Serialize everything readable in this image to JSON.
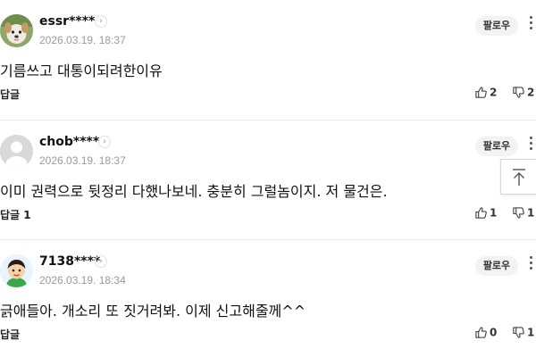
{
  "comments": [
    {
      "user": "essr****",
      "date": "2026.03.19. 18:37",
      "follow_label": "팔로우",
      "text": "기름쓰고 대통이되려한이유",
      "reply_label": "답글",
      "likes": "2",
      "dislikes": "2",
      "avatar": "dog-photo"
    },
    {
      "user": "chob****",
      "date": "2026.03.19. 18:37",
      "follow_label": "팔로우",
      "text": "이미 권력으로 뒷정리 다했나보네. 충분히 그럴놈이지. 저 물건은.",
      "reply_label": "답글 1",
      "likes": "1",
      "dislikes": "1",
      "avatar": "default-person"
    },
    {
      "user": "7138****",
      "date": "2026.03.19. 18:34",
      "follow_label": "팔로우",
      "text": "긁애들아. 개소리 또 짓거려봐. 이제 신고해줄께^^",
      "reply_label": "답글",
      "likes": "0",
      "dislikes": "1",
      "avatar": "cartoon-character"
    }
  ],
  "icons": {
    "chevron": "chevron-right-icon",
    "more": "more-vertical-icon",
    "like": "thumbs-up-icon",
    "dislike": "thumbs-down-icon",
    "scroll_top": "arrow-up-icon"
  },
  "colors": {
    "text": "#111111",
    "date": "#9a9a9a",
    "follow_bg": "#f3f3f3",
    "divider": "#ececec"
  }
}
